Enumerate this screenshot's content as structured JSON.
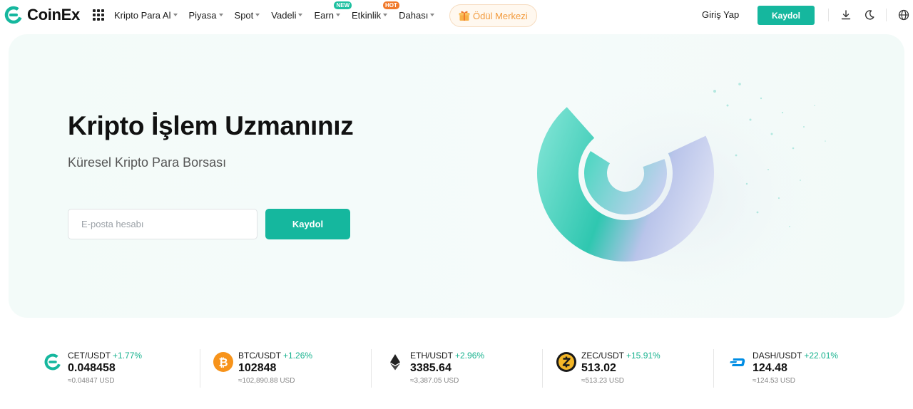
{
  "brand": {
    "name": "CoinEx",
    "color": "#15b79e"
  },
  "nav": {
    "items": [
      {
        "label": "Kripto Para Al",
        "caret": true
      },
      {
        "label": "Piyasa",
        "caret": true
      },
      {
        "label": "Spot",
        "caret": true
      },
      {
        "label": "Vadeli",
        "caret": true
      },
      {
        "label": "Earn",
        "caret": true,
        "badge": "NEW"
      },
      {
        "label": "Etkinlik",
        "caret": true,
        "badge": "HOT"
      },
      {
        "label": "Dahası",
        "caret": true
      }
    ],
    "reward_label": "Ödül Merkezi",
    "login_label": "Giriş Yap",
    "signup_label": "Kaydol",
    "icons": [
      "download-icon",
      "moon-icon",
      "globe-icon"
    ]
  },
  "hero": {
    "title": "Kripto İşlem Uzmanınız",
    "subtitle": "Küresel Kripto Para Borsası",
    "email_placeholder": "E-posta hesabı",
    "signup_label": "Kaydol"
  },
  "tickers": [
    {
      "pair": "CET/USDT",
      "change": "+1.77%",
      "price": "0.048458",
      "usd": "≈0.04847 USD",
      "icon": "cet-icon",
      "color": "#15b79e"
    },
    {
      "pair": "BTC/USDT",
      "change": "+1.26%",
      "price": "102848",
      "usd": "≈102,890.88 USD",
      "icon": "btc-icon",
      "color": "#f7931a"
    },
    {
      "pair": "ETH/USDT",
      "change": "+2.96%",
      "price": "3385.64",
      "usd": "≈3,387.05 USD",
      "icon": "eth-icon",
      "color": "#222222"
    },
    {
      "pair": "ZEC/USDT",
      "change": "+15.91%",
      "price": "513.02",
      "usd": "≈513.23 USD",
      "icon": "zec-icon",
      "color": "#f4b728"
    },
    {
      "pair": "DASH/USDT",
      "change": "+22.01%",
      "price": "124.48",
      "usd": "≈124.53 USD",
      "icon": "dash-icon",
      "color": "#008de4"
    }
  ]
}
